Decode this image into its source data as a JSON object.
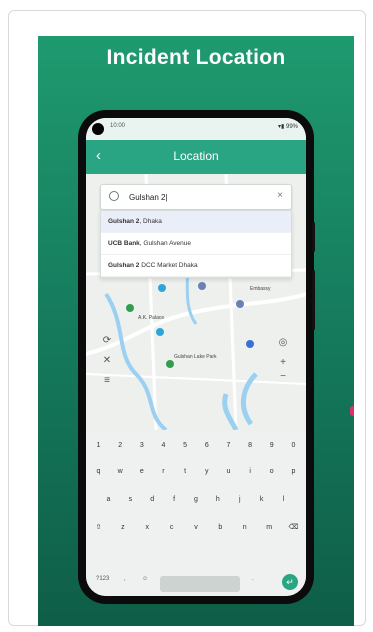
{
  "promo": {
    "title": "Incident Location"
  },
  "status": {
    "time": "10:00",
    "icons": "▾▮ 99%"
  },
  "appbar": {
    "back": "‹",
    "title": "Location"
  },
  "search": {
    "value": "Gulshan 2|",
    "clear": "×"
  },
  "suggestions": [
    {
      "bold": "Gulshan 2",
      "rest": ", Dhaka"
    },
    {
      "bold": "UCB Bank",
      "rest": ", Gulshan Avenue"
    },
    {
      "bold": "Gulshan 2",
      "rest": " DCC Market Dhaka"
    }
  ],
  "map_labels": [
    "A.K. Palace",
    "Gulshan Lake Park",
    "Embassy"
  ],
  "keyboard": {
    "row1": [
      "1",
      "2",
      "3",
      "4",
      "5",
      "6",
      "7",
      "8",
      "9",
      "0"
    ],
    "row2": [
      "q",
      "w",
      "e",
      "r",
      "t",
      "y",
      "u",
      "i",
      "o",
      "p"
    ],
    "row3": [
      "a",
      "s",
      "d",
      "f",
      "g",
      "h",
      "j",
      "k",
      "l"
    ],
    "row4": [
      "⇧",
      "z",
      "x",
      "c",
      "v",
      "b",
      "n",
      "m",
      "⌫"
    ],
    "symbols": "?123",
    "comma": ",",
    "emoji": "☺",
    "period": ".",
    "enter": "↵"
  },
  "colors": {
    "brand": "#2aa583",
    "promo_top": "#1f9a6f",
    "promo_bottom": "#0f5e47"
  }
}
